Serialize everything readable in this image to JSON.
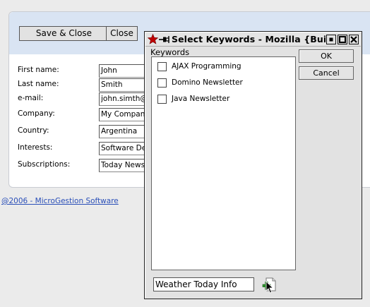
{
  "form": {
    "toolbar": {
      "save_close_label": "Save & Close",
      "close_label": "Close"
    },
    "fields": [
      {
        "label": "First name:",
        "value": "John"
      },
      {
        "label": "Last name:",
        "value": "Smith"
      },
      {
        "label": "e-mail:",
        "value": "john.simth@m"
      },
      {
        "label": "Company:",
        "value": "My Company"
      },
      {
        "label": "Country:",
        "value": "Argentina"
      },
      {
        "label": "Interests:",
        "value": "Software Dev"
      },
      {
        "label": "Subscriptions:",
        "value": "Today News"
      }
    ]
  },
  "footer": {
    "link_text": "@2006 - MicroGestion Software"
  },
  "dialog": {
    "title": "Select Keywords - Mozilla {Build ID:",
    "list_label": "Keywords",
    "keywords": [
      {
        "label": "AJAX Programming",
        "checked": false
      },
      {
        "label": "Domino Newsletter",
        "checked": false
      },
      {
        "label": "Java Newsletter",
        "checked": false
      }
    ],
    "ok_label": "OK",
    "cancel_label": "Cancel",
    "new_keyword_value": "Weather Today Info",
    "icons": [
      "star-icon",
      "pin-icon",
      "minimize-icon",
      "maximize-icon",
      "close-icon",
      "add-document-icon",
      "mouse-cursor-icon"
    ]
  },
  "colors": {
    "page_bg": "#ebebeb",
    "toolbar_band": "#d9e4f3",
    "link": "#2a4fb8",
    "add_icon_green": "#2e9a2e",
    "star_red": "#c00000"
  }
}
